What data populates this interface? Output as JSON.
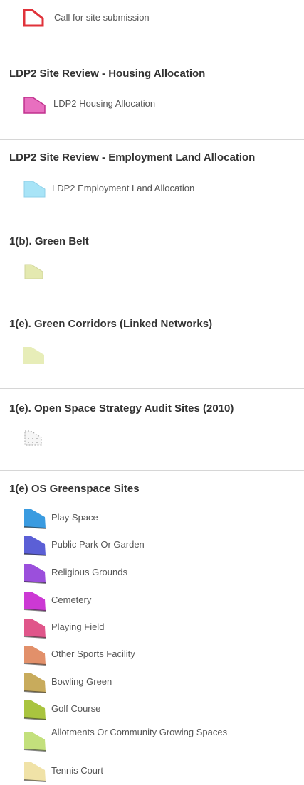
{
  "legend": {
    "top_item": {
      "label": "Call for site submission",
      "symbol": "red-outline-polygon-icon",
      "color": "#e0323a"
    },
    "layers": [
      {
        "title": "LDP2 Site Review - Housing Allocation",
        "items": [
          {
            "label": "LDP2 Housing Allocation",
            "color": "#e86fbf",
            "stroke": "#c0318e"
          }
        ]
      },
      {
        "title": "LDP2 Site Review - Employment Land Allocation",
        "items": [
          {
            "label": "LDP2 Employment Land Allocation",
            "color": "#a8e4f7",
            "stroke": "#8fd0e8"
          }
        ]
      },
      {
        "title": "1(b). Green Belt",
        "items": [
          {
            "label": "",
            "color": "#e4e9b0",
            "stroke": "#d0d59a"
          }
        ]
      },
      {
        "title": "1(e). Green Corridors (Linked Networks)",
        "items": [
          {
            "label": "",
            "color": "#e7edb8",
            "stroke": "#e7edb8"
          }
        ]
      },
      {
        "title": "1(e). Open Space Strategy Audit Sites (2010)",
        "items": [
          {
            "label": "",
            "color": "#f4f4f4",
            "stroke": "#9a9a9a",
            "pattern": "dotted"
          }
        ]
      },
      {
        "title": "1(e) OS Greenspace Sites",
        "items": [
          {
            "label": "Play Space",
            "color": "#3a9be0"
          },
          {
            "label": "Public Park Or Garden",
            "color": "#5b5fd6"
          },
          {
            "label": "Religious Grounds",
            "color": "#9b4fdc"
          },
          {
            "label": "Cemetery",
            "color": "#cc39d4"
          },
          {
            "label": "Playing Field",
            "color": "#e0568a"
          },
          {
            "label": "Other Sports Facility",
            "color": "#e2906a"
          },
          {
            "label": "Bowling Green",
            "color": "#c8ab5c"
          },
          {
            "label": "Golf Course",
            "color": "#a9c43f"
          },
          {
            "label": "Allotments Or Community Growing Spaces",
            "color": "#c3e07c"
          },
          {
            "label": "Tennis Court",
            "color": "#f0e2a7"
          }
        ]
      }
    ]
  }
}
